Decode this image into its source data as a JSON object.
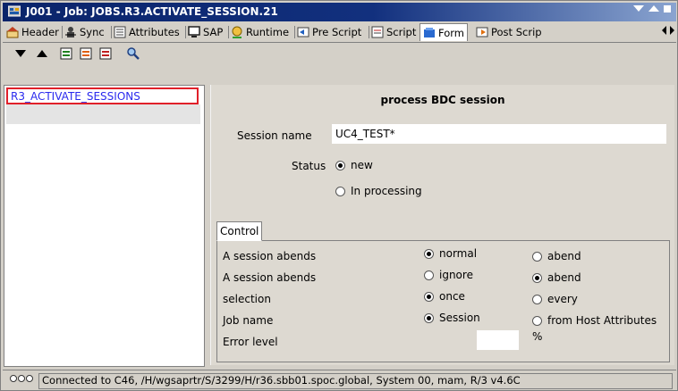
{
  "window": {
    "title": "J001 - Job: JOBS.R3.ACTIVATE_SESSION.21"
  },
  "tabs": [
    {
      "label": "Header",
      "icon": "header-icon"
    },
    {
      "label": "Sync",
      "icon": "sync-icon"
    },
    {
      "label": "Attributes",
      "icon": "attributes-icon"
    },
    {
      "label": "SAP",
      "icon": "sap-icon"
    },
    {
      "label": "Runtime",
      "icon": "runtime-icon"
    },
    {
      "label": "Pre Script",
      "icon": "pre-script-icon"
    },
    {
      "label": "Script",
      "icon": "script-icon"
    },
    {
      "label": "Form",
      "icon": "form-icon",
      "active": true
    },
    {
      "label": "Post Scrip",
      "icon": "post-script-icon"
    }
  ],
  "tree": {
    "selected_item": "R3_ACTIVATE_SESSIONS"
  },
  "form": {
    "heading": "process BDC session",
    "session_name_label": "Session name",
    "session_name_value": "UC4_TEST*",
    "status_label": "Status",
    "status_options": [
      "new",
      "In processing"
    ],
    "status_selected": "new"
  },
  "control": {
    "tab_label": "Control",
    "rows": [
      {
        "label": "A session abends",
        "opt1": "normal",
        "opt2": "abend",
        "selected": "opt1"
      },
      {
        "label": "A session abends",
        "opt1": "ignore",
        "opt2": "abend",
        "selected": "opt2"
      },
      {
        "label": "selection",
        "opt1": "once",
        "opt2": "every",
        "selected": "opt1"
      },
      {
        "label": "Job name",
        "opt1": "Session",
        "opt2": "from Host Attributes",
        "selected": "opt1"
      }
    ],
    "error_level_label": "Error level",
    "error_level_value": "",
    "error_level_unit": "%"
  },
  "statusbar": {
    "text": "Connected to C46, /H/wgsaprtr/S/3299/H/r36.sbb01.spoc.global, System 00, mam, R/3 v4.6C"
  },
  "colors": {
    "titlebar": "#0a246a",
    "selection_border": "#e0202a",
    "tree_text": "#2a2aee"
  }
}
